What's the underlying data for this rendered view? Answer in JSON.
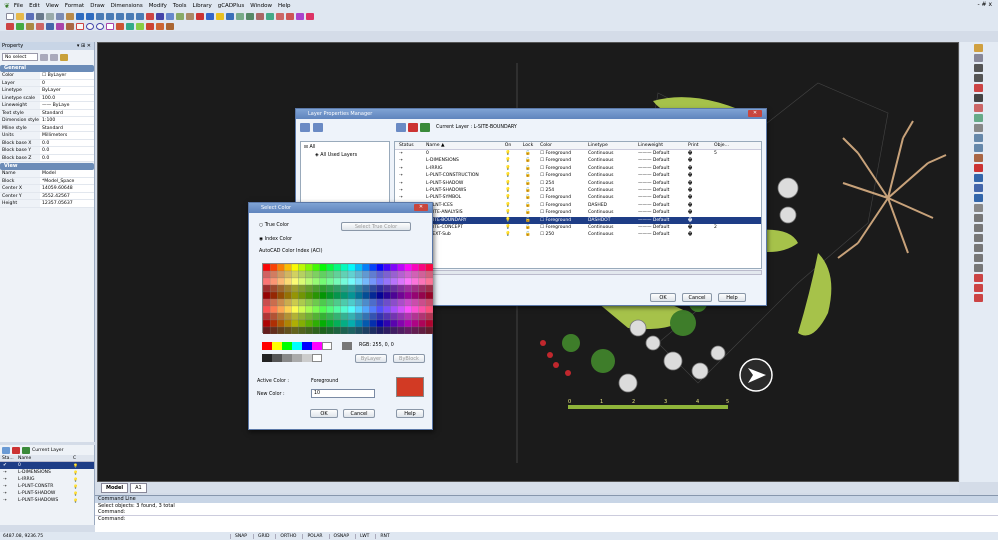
{
  "menu": {
    "items": [
      "File",
      "Edit",
      "View",
      "Format",
      "Draw",
      "Dimensions",
      "Modify",
      "Tools",
      "Library",
      "gCADPlus",
      "Window",
      "Help"
    ],
    "window_controls": "- # x"
  },
  "property_panel": {
    "title": "Property",
    "pin": "▾ ⊞ ✕",
    "select_value": "No select",
    "general_header": "General",
    "general_rows": [
      {
        "k": "Color",
        "v": "☐ ByLayer"
      },
      {
        "k": "Layer",
        "v": "0"
      },
      {
        "k": "Linetype",
        "v": "ByLayer"
      },
      {
        "k": "Linetype scale",
        "v": "100.0"
      },
      {
        "k": "Lineweight",
        "v": "—— ByLaye"
      },
      {
        "k": "Text style",
        "v": "Standard"
      },
      {
        "k": "Dimension style",
        "v": "1:100"
      },
      {
        "k": "Mline style",
        "v": "Standard"
      },
      {
        "k": "Units",
        "v": "Millimeters"
      },
      {
        "k": "Block base X",
        "v": "0.0"
      },
      {
        "k": "Block base Y",
        "v": "0.0"
      },
      {
        "k": "Block base Z",
        "v": "0.0"
      }
    ],
    "view_header": "View",
    "view_rows": [
      {
        "k": "Name",
        "v": "Model"
      },
      {
        "k": "Block",
        "v": "*Model_Space"
      },
      {
        "k": "Center X",
        "v": "14059.60648"
      },
      {
        "k": "Center Y",
        "v": "3552.42567"
      },
      {
        "k": "Height",
        "v": "12357.05637"
      }
    ]
  },
  "layer_mini": {
    "current_label": "Current Layer",
    "col_status": "Sta...",
    "col_name": "Name",
    "col_c": "C",
    "rows": [
      "0",
      "L-DIMENSIONS",
      "L-IRRIG",
      "L-PLNT-CONSTR",
      "L-PLNT-SHADOW",
      "L-PLNT-SHADOWS"
    ]
  },
  "tabs": [
    "Model",
    "A1"
  ],
  "command": {
    "header": "Command Line",
    "lines": [
      "Select objects: 3 found, 3 total",
      "Command:"
    ],
    "prompt": "Command:"
  },
  "status": {
    "coords": "6487.08, 9236.75",
    "toggles": [
      "SNAP",
      "GRID",
      "ORTHO",
      "POLAR",
      "OSNAP",
      "LWT",
      "RNT"
    ]
  },
  "layer_dialog": {
    "title": "Layer Properties Manager",
    "current_layer": "Current Layer : L-SITE-BOUNDARY",
    "tree_root": "All",
    "tree_child": "All Used Layers",
    "headers": [
      "Status",
      "Name ▲",
      "On",
      "Lock",
      "Color",
      "Linetype",
      "Lineweight",
      "Print",
      "Obje..."
    ],
    "rows": [
      {
        "name": "0",
        "color": "Foreground",
        "linetype": "Continuous",
        "lw": "Default",
        "obj": "5"
      },
      {
        "name": "L-DIMENSIONS",
        "color": "Foreground",
        "linetype": "Continuous",
        "lw": "Default",
        "obj": ""
      },
      {
        "name": "L-IRRIG",
        "color": "Foreground",
        "linetype": "Continuous",
        "lw": "Default",
        "obj": ""
      },
      {
        "name": "L-PLNT-CONSTRUCTION",
        "color": "Foreground",
        "linetype": "Continuous",
        "lw": "Default",
        "obj": ""
      },
      {
        "name": "L-PLNT-SHADOW",
        "color": "254",
        "linetype": "Continuous",
        "lw": "Default",
        "obj": ""
      },
      {
        "name": "L-PLNT-SHADOWS",
        "color": "254",
        "linetype": "Continuous",
        "lw": "Default",
        "obj": ""
      },
      {
        "name": "L-PLNT-SYMBOL",
        "color": "Foreground",
        "linetype": "Continuous",
        "lw": "Default",
        "obj": ""
      },
      {
        "name": "L-PLNT-ICES",
        "color": "Foreground",
        "linetype": "DASHED",
        "lw": "Default",
        "obj": ""
      },
      {
        "name": "L-SITE-ANALYSIS",
        "color": "Foreground",
        "linetype": "Continuous",
        "lw": "Default",
        "obj": ""
      },
      {
        "name": "L-SITE-BOUNDARY",
        "color": "Foreground",
        "linetype": "DASHDOT",
        "lw": "Default",
        "obj": "",
        "selected": true
      },
      {
        "name": "L-SITE-CONCEPT",
        "color": "Foreground",
        "linetype": "Continuous",
        "lw": "Default",
        "obj": "2"
      },
      {
        "name": "L-TEXT-Sub",
        "color": "250",
        "linetype": "Continuous",
        "lw": "Default",
        "obj": ""
      }
    ],
    "ok": "OK",
    "cancel": "Cancel",
    "help": "Help"
  },
  "color_dialog": {
    "title": "Select Color",
    "true_color": "True Color",
    "select_true_color": "Select True Color",
    "index_color": "Index Color",
    "aci_label": "AutoCAD Color Index (ACI)",
    "rgb": "RGB: 255, 0, 0",
    "bylayer": "ByLayer",
    "byblock": "ByBlock",
    "active_color_label": "Active Color :",
    "active_color_value": "Foreground",
    "new_color_label": "New Color :",
    "new_color_value": "10",
    "ok": "OK",
    "cancel": "Cancel",
    "help": "Help",
    "swatch": "#d23a24"
  },
  "colors": {
    "accent": "#1e3d86",
    "canvas": "#1b1b1b",
    "plant_green": "#a6c24a",
    "tree_brown": "#c8a27a"
  },
  "scale_labels": [
    "0",
    "1",
    "2",
    "3",
    "4",
    "5"
  ]
}
